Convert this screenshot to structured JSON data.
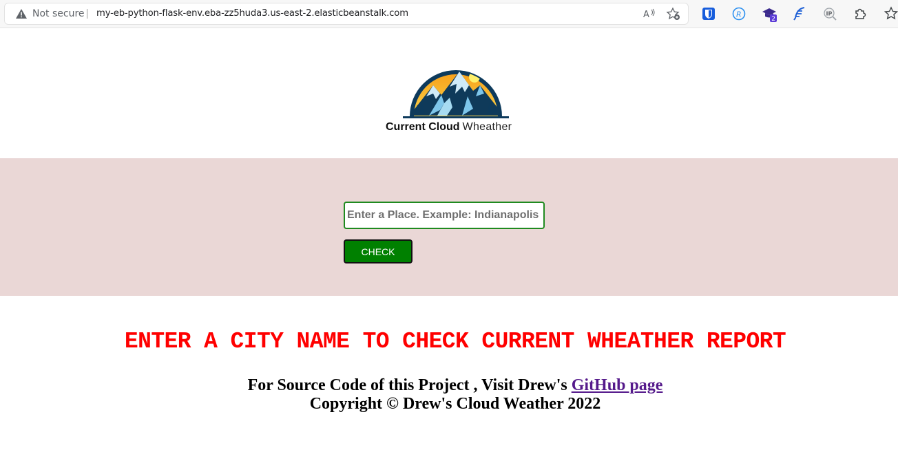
{
  "browser": {
    "security_label": "Not secure",
    "url": "my-eb-python-flask-env.eba-zz5huda3.us-east-2.elasticbeanstalk.com",
    "extension_badge": "2",
    "icons": [
      "warning-icon",
      "read-aloud-icon",
      "favorites-icon",
      "bitwarden-icon",
      "extension-r-icon",
      "extension-badge-icon",
      "extension-feather-icon",
      "ip-icon",
      "extensions-puzzle-icon",
      "favorites-bar-icon"
    ]
  },
  "header": {
    "brand_bold": "Current Cloud",
    "brand_light": "Wheather"
  },
  "search": {
    "placeholder": "Enter a Place. Example: Indianapolis",
    "value": "",
    "button_label": "CHECK"
  },
  "main": {
    "message": "ENTER A CITY NAME TO CHECK CURRENT WHEATHER REPORT"
  },
  "footer": {
    "source_text": "For Source Code of this Project , Visit Drew's ",
    "github_link": "GitHub page",
    "copyright": "Copyright © Drew's Cloud Weather 2022"
  },
  "colors": {
    "band": "#ead7d6",
    "accent_green": "#008000",
    "message_red": "#ff0000",
    "link_purple": "#551a8b"
  }
}
